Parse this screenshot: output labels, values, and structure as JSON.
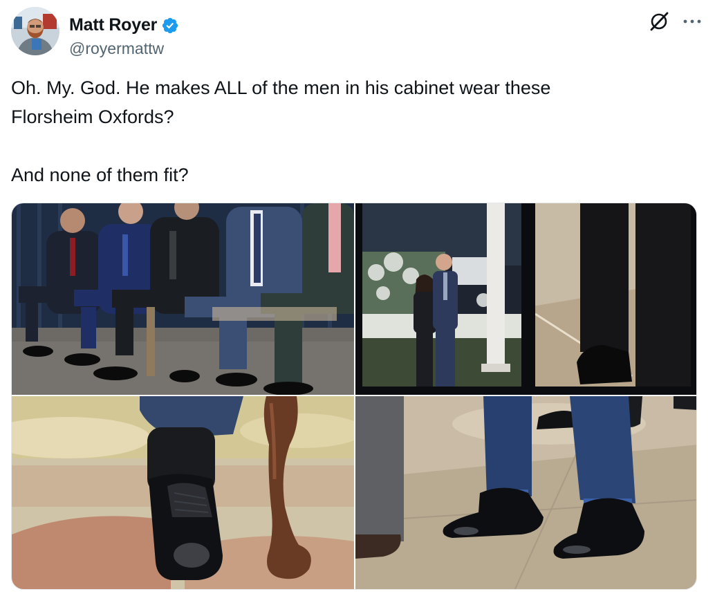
{
  "author": {
    "name": "Matt Royer",
    "handle": "@royermattw",
    "verified": true,
    "verified_color": "#1d9bf0"
  },
  "icons": {
    "verified": "verified-badge-icon",
    "grok": "grok-icon",
    "more": "more-options-icon"
  },
  "post": {
    "text": "Oh. My. God. He makes ALL of the men in his cabinet wear these\nFlorsheim Oxfords?\n\nAnd none of them fit?"
  },
  "media": {
    "count": 4,
    "images": [
      "Men in suits seated in a row wearing black oxford shoes",
      "Couple posing outdoors at night beside a white column, with a close-up of trousers and a black shoe",
      "Close-up of a black laced oxford shoe next to a carved wooden chair leg",
      "Close-up of navy trousers and black oxford shoes on a tiled floor"
    ]
  }
}
